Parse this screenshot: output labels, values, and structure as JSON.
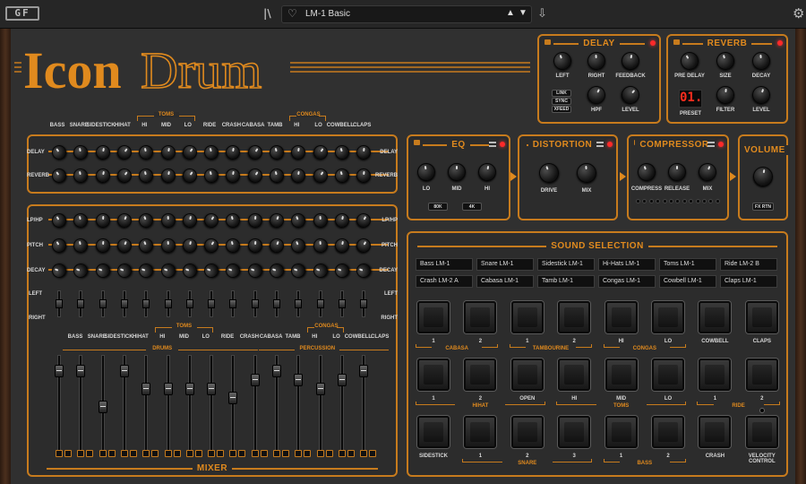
{
  "host": {
    "logo": "GF",
    "library_icon": "library-icon",
    "preset_name": "LM-1 Basic",
    "heart_icon": "heart-icon",
    "up": "▲",
    "down": "▼",
    "download": "⇩",
    "gear": "⚙"
  },
  "brand": {
    "title1": "Icon",
    "title2": "Drum"
  },
  "delay": {
    "title": "DELAY",
    "knobs": [
      "LEFT",
      "RIGHT",
      "FEEDBACK",
      "HPF",
      "LEVEL"
    ],
    "buttons": [
      "LINK",
      "SYNC",
      "XFEED"
    ]
  },
  "reverb": {
    "title": "REVERB",
    "knobs": [
      "PRE DELAY",
      "SIZE",
      "DECAY",
      "FILTER",
      "LEVEL"
    ],
    "preset_value": "01.",
    "preset_label": "PRESET"
  },
  "instruments": {
    "names": [
      "BASS",
      "SNARE",
      "SIDESTICK",
      "HIHAT",
      "HI",
      "MID",
      "LO",
      "RIDE",
      "CRASH",
      "CABASA",
      "TAMB",
      "HI",
      "LO",
      "COWBELL",
      "CLAPS"
    ],
    "toms": "TOMS",
    "congas": "CONGAS"
  },
  "sends": {
    "rows": [
      "DELAY",
      "REVERB"
    ]
  },
  "channels": {
    "rows": [
      "LP/HP",
      "PITCH",
      "DECAY"
    ],
    "left": "LEFT",
    "right": "RIGHT"
  },
  "mixer": {
    "title": "MIXER",
    "drums": "DRUMS",
    "percussion": "PERCUSSION"
  },
  "eq": {
    "title": "EQ",
    "knobs": [
      "LO",
      "MID",
      "HI"
    ],
    "buttons": [
      "80K",
      "4K"
    ]
  },
  "distortion": {
    "title": "DISTORTION",
    "knobs": [
      "DRIVE",
      "MIX"
    ]
  },
  "compressor": {
    "title": "COMPRESSOR",
    "knobs": [
      "COMPRESS",
      "RELEASE",
      "MIX"
    ]
  },
  "volume": {
    "title": "VOLUME",
    "button": "FX RTN"
  },
  "sound": {
    "title": "SOUND SELECTION",
    "slots": [
      "Bass LM-1",
      "Snare LM-1",
      "Sidestick LM-1",
      "Hi-Hats LM-1",
      "Toms LM-1",
      "Ride LM-2 B",
      "Crash LM-2 A",
      "Cabasa LM-1",
      "Tamb LM-1",
      "Congas LM-1",
      "Cowbell LM-1",
      "Claps LM-1"
    ],
    "row1_labels": [
      "1",
      "2",
      "1",
      "2",
      "HI",
      "LO",
      "COWBELL",
      "CLAPS"
    ],
    "row1_groups": [
      "CABASA",
      "TAMBOURINE",
      "CONGAS"
    ],
    "row2_labels": [
      "1",
      "2",
      "OPEN",
      "HI",
      "MID",
      "LO",
      "1",
      "2"
    ],
    "row2_groups": [
      "HIHAT",
      "TOMS",
      "RIDE"
    ],
    "row3_labels": [
      "SIDESTICK",
      "1",
      "2",
      "3",
      "1",
      "2",
      "CRASH",
      "VELOCITY CONTROL"
    ],
    "row3_groups": [
      "SNARE",
      "BASS"
    ]
  },
  "colors": {
    "accent": "#e08a1e",
    "led": "#ff2a2a"
  }
}
